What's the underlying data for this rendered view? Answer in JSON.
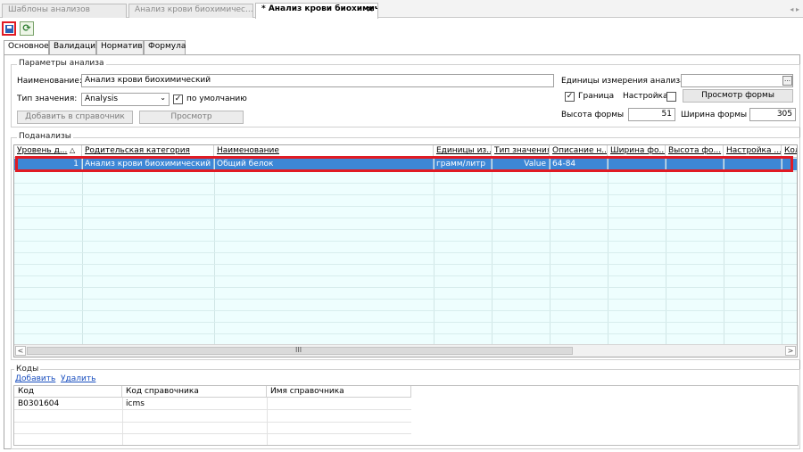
{
  "doc_tabs": [
    {
      "label": "Шаблоны анализов"
    },
    {
      "label": "Анализ крови биохимичес..."
    },
    {
      "label": "* Анализ крови биохимич...",
      "close": "×"
    }
  ],
  "tab_scroll": "◂ ▸",
  "subtabs": [
    "Основное",
    "Валидация",
    "Норматив",
    "Формула"
  ],
  "params": {
    "title": "Параметры анализа",
    "name_label": "Наименование:",
    "name_value": "Анализ крови биохимический",
    "value_type_label": "Тип значения:",
    "value_type_value": "Analysis",
    "default_label": "по умолчанию",
    "default_checked": "✓",
    "add_to_ref_button": "Добавить в справочник",
    "preview_button": "Просмотр",
    "units_label": "Единицы измерения анализа:",
    "units_value": "",
    "border_label": "Граница",
    "border_checked": "✓",
    "settings_label": "Настройка",
    "form_preview_button": "Просмотр формы",
    "form_height_label": "Высота формы",
    "form_height_value": "51",
    "form_width_label": "Ширина формы",
    "form_width_value": "305"
  },
  "subanalyses": {
    "title": "Поданализы",
    "columns": [
      "Уровень д...",
      "Родительская категория",
      "Наименование",
      "Единицы из...",
      "Тип значения",
      "Описание н...",
      "Ширина фо...",
      "Высота фо...",
      "Настройка ...",
      "Кол"
    ],
    "sort_indicator": "△",
    "rows": [
      [
        "1",
        "Анализ крови биохимический",
        "Общий белок",
        "грамм/литр",
        "Value",
        "64-84",
        "",
        "",
        "",
        ""
      ]
    ],
    "scroll_grip": "III"
  },
  "codes": {
    "title": "Коды",
    "add_link": "Добавить",
    "delete_link": "Удалить",
    "columns": [
      "Код",
      "Код справочника",
      "Имя справочника"
    ],
    "rows": [
      [
        "B0301604",
        "icms",
        ""
      ]
    ]
  },
  "colors": {
    "selection": "#3d87d6",
    "highlight": "#e01b24",
    "grid_bg": "#eefefe"
  }
}
